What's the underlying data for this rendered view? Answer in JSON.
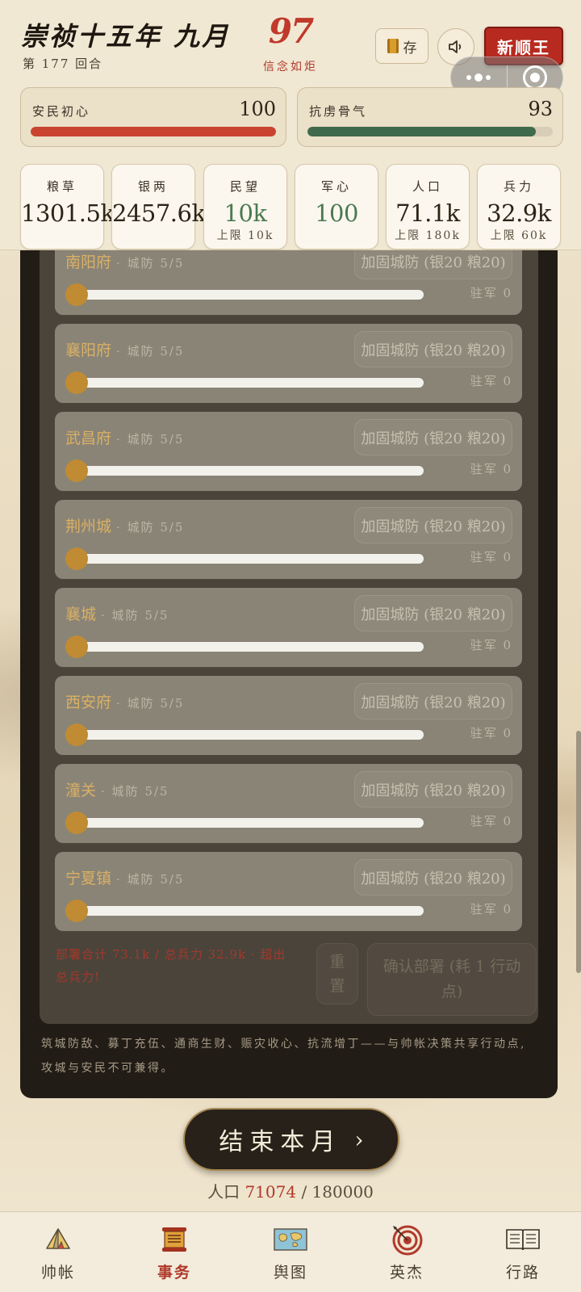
{
  "header": {
    "title": "崇祯十五年 九月",
    "round": "第 177 回合",
    "score": "97",
    "score_label": "信念如炬",
    "save_label": "存",
    "new_button": "新顺王"
  },
  "bars": [
    {
      "label": "安民初心",
      "value": "100",
      "fill": 1.0,
      "color": "#c9432f"
    },
    {
      "label": "抗虏骨气",
      "value": "93",
      "fill": 0.93,
      "color": "#3f6b4c"
    }
  ],
  "stats": [
    {
      "label": "粮草",
      "value": "1301.5k",
      "cap": "",
      "color": "dark"
    },
    {
      "label": "银两",
      "value": "2457.6k",
      "cap": "",
      "color": "dark"
    },
    {
      "label": "民望",
      "value": "10k",
      "cap": "上限 10k",
      "color": "green"
    },
    {
      "label": "军心",
      "value": "100",
      "cap": "",
      "color": "green"
    },
    {
      "label": "人口",
      "value": "71.1k",
      "cap": "上限 180k",
      "color": "dark"
    },
    {
      "label": "兵力",
      "value": "32.9k",
      "cap": "上限 60k",
      "color": "dark"
    }
  ],
  "cities": [
    {
      "name": "南阳府",
      "defense": "· 城防 5/5",
      "button": "加固城防 (银20 粮20)",
      "garrison": "驻军 0",
      "slider": 0
    },
    {
      "name": "襄阳府",
      "defense": "· 城防 5/5",
      "button": "加固城防 (银20 粮20)",
      "garrison": "驻军 0",
      "slider": 0
    },
    {
      "name": "武昌府",
      "defense": "· 城防 5/5",
      "button": "加固城防 (银20 粮20)",
      "garrison": "驻军 0",
      "slider": 0
    },
    {
      "name": "荆州城",
      "defense": "· 城防 5/5",
      "button": "加固城防 (银20 粮20)",
      "garrison": "驻军 0",
      "slider": 0
    },
    {
      "name": "襄城",
      "defense": "· 城防 5/5",
      "button": "加固城防 (银20 粮20)",
      "garrison": "驻军 0",
      "slider": 0
    },
    {
      "name": "西安府",
      "defense": "· 城防 5/5",
      "button": "加固城防 (银20 粮20)",
      "garrison": "驻军 0",
      "slider": 0
    },
    {
      "name": "潼关",
      "defense": "· 城防 5/5",
      "button": "加固城防 (银20 粮20)",
      "garrison": "驻军 0",
      "slider": 0
    },
    {
      "name": "宁夏镇",
      "defense": "· 城防 5/5",
      "button": "加固城防 (银20 粮20)",
      "garrison": "驻军 0",
      "slider": 0
    }
  ],
  "deploy": {
    "warning": "部署合计 73.1k / 总兵力 32.9k · 超出总兵力!",
    "reset": "重置",
    "confirm": "确认部署 (耗 1 行动点)"
  },
  "panel_note": "筑城防敌、募丁充伍、通商生财、赈灾收心、抗流增丁——与帅帐决策共享行动点, 攻城与安民不可兼得。",
  "end_turn": {
    "label": "结束本月",
    "chevron": "›"
  },
  "population": {
    "prefix": "人口",
    "current": "71074",
    "sep": "/",
    "max": "180000"
  },
  "nav": [
    {
      "label": "帅帐",
      "icon": "tent-icon",
      "active": false
    },
    {
      "label": "事务",
      "icon": "scroll-icon",
      "active": true
    },
    {
      "label": "舆图",
      "icon": "map-icon",
      "active": false
    },
    {
      "label": "英杰",
      "icon": "target-icon",
      "active": false
    },
    {
      "label": "行路",
      "icon": "book-icon",
      "active": false
    }
  ],
  "colors": {
    "accent": "#b72a20",
    "gold": "#c08b32",
    "panel": "#221c16"
  }
}
